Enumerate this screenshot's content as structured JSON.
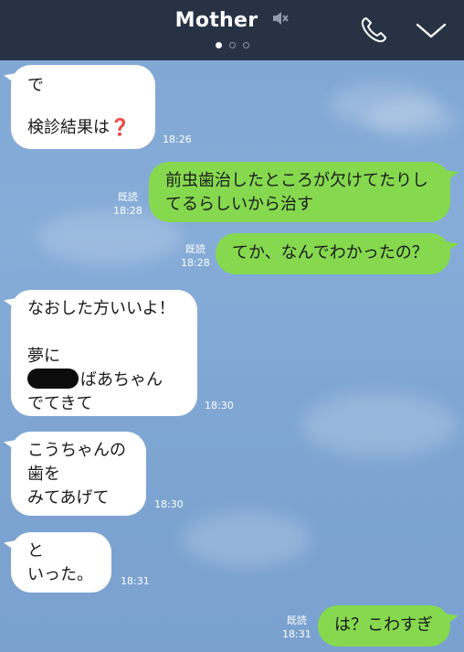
{
  "header": {
    "title": "Mother",
    "icons": {
      "mute": "speaker-muted-icon",
      "call": "phone-icon",
      "menu": "chevron-down-icon"
    },
    "pager": {
      "count": 3,
      "active": 1
    }
  },
  "colors": {
    "header_bg": "#273345",
    "incoming_bubble": "#ffffff",
    "outgoing_bubble": "#86d94f",
    "background": "#7fa6d4"
  },
  "messages": [
    {
      "direction": "in",
      "lines": [
        "で",
        "",
        "検診結果は"
      ],
      "emoji": "❓",
      "time": "18:26"
    },
    {
      "direction": "out",
      "lines": [
        "前虫歯治したところが欠けてたりし",
        "てるらしいから治す"
      ],
      "read": "既読",
      "time": "18:28"
    },
    {
      "direction": "out",
      "lines": [
        "てか、なんでわかったの？"
      ],
      "read": "既読",
      "time": "18:28"
    },
    {
      "direction": "in",
      "lines": [
        "なおした方いいよ！",
        "",
        "夢に",
        "ばあちゃん",
        "でてきて"
      ],
      "time": "18:30"
    },
    {
      "direction": "in",
      "lines": [
        "こうちゃんの",
        "歯を",
        "みてあげて"
      ],
      "time": "18:30"
    },
    {
      "direction": "in",
      "lines": [
        "と",
        "いった。"
      ],
      "time": "18:31"
    },
    {
      "direction": "out",
      "lines": [
        "は？こわすぎ"
      ],
      "read": "既読",
      "time": "18:31"
    }
  ]
}
